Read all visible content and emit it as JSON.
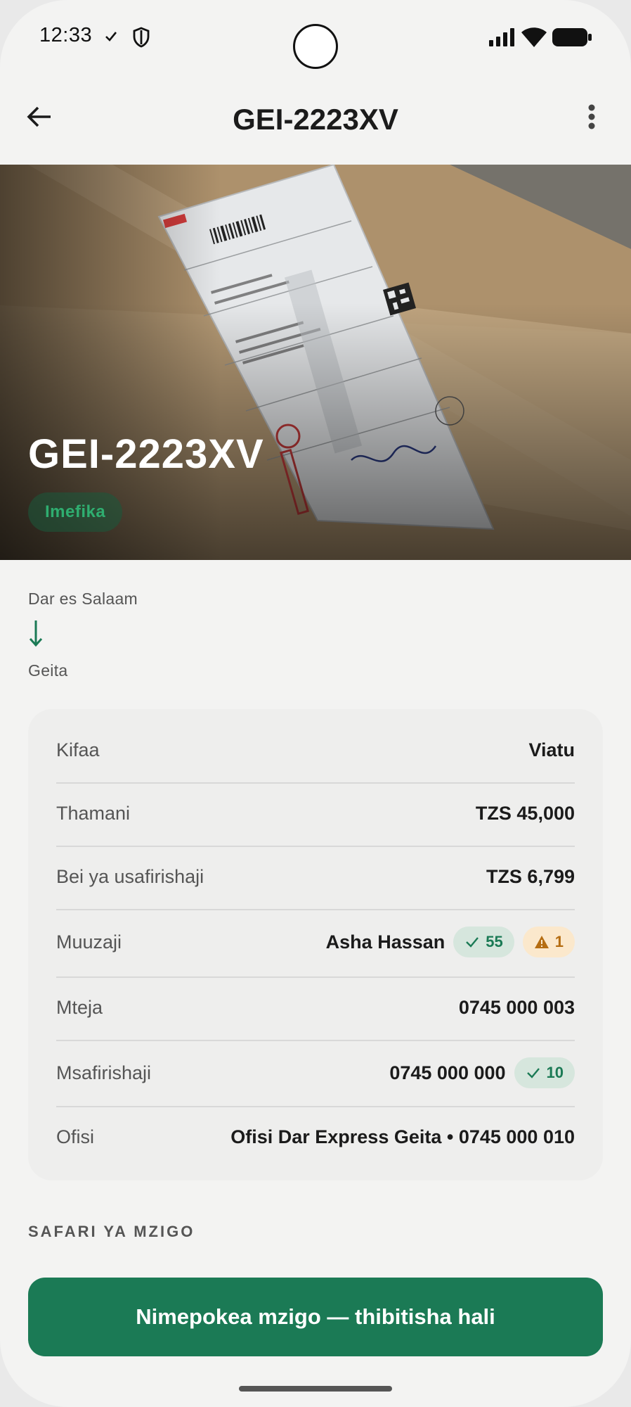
{
  "status_bar": {
    "time": "12:33",
    "icons": [
      "check-icon",
      "shield-icon",
      "signal-icon",
      "wifi-icon",
      "battery-icon"
    ]
  },
  "app_bar": {
    "title": "GEI-2223XV",
    "icons": [
      "arrow-back-icon",
      "more-vert-icon"
    ]
  },
  "hero": {
    "title": "GEI-2223XV",
    "status_badge": "Imefika",
    "status_color": "#2fae70"
  },
  "route": {
    "from": "Dar es Salaam",
    "to": "Geita",
    "arrow_color": "#1b7a55"
  },
  "details": {
    "rows": [
      {
        "label": "Kifaa",
        "value": "Viatu"
      },
      {
        "label": "Thamani",
        "value": "TZS 45,000"
      },
      {
        "label": "Bei ya usafirishaji",
        "value": "TZS 6,799"
      },
      {
        "label": "Muuzaji",
        "value": "Asha Hassan",
        "rating_count": "55",
        "warning_count": "1"
      },
      {
        "label": "Mteja",
        "value": "0745 000 003"
      },
      {
        "label": "Msafirishaji",
        "value": "0745 000 000",
        "rating_count": "10"
      },
      {
        "label": "Ofisi",
        "value": "Ofisi Dar Express Geita • 0745 000 010"
      }
    ]
  },
  "section_title": "SAFARI YA MZIGO",
  "cta": {
    "label": "Nimepokea mzigo — thibitisha hali",
    "color": "#1b7a55"
  }
}
